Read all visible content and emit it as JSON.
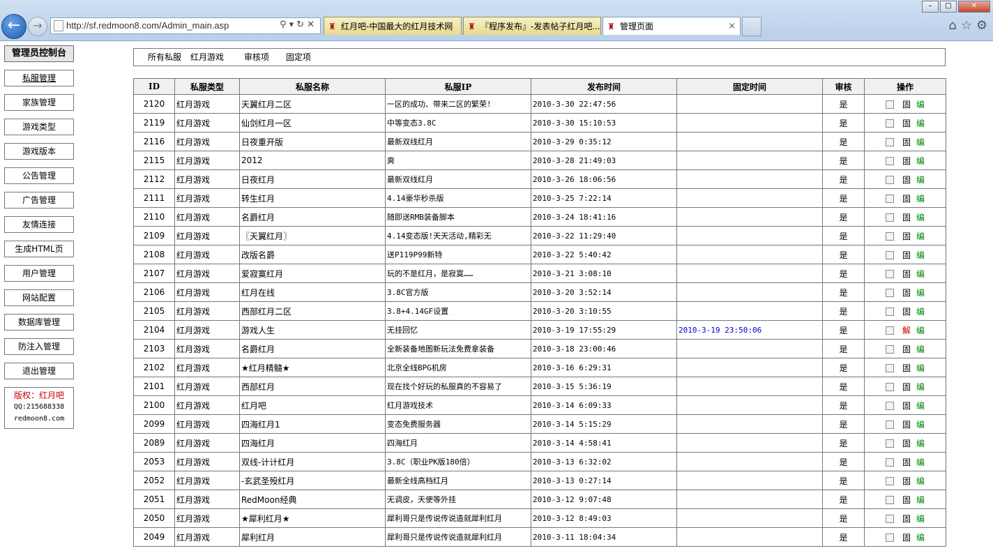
{
  "browser": {
    "url": "http://sf.redmoon8.com/Admin_main.asp",
    "tabs": [
      {
        "title": "红月吧-中国最大的红月技术网"
      },
      {
        "title": "『程序发布』-发表帖子红月吧..."
      },
      {
        "title": "管理页面"
      }
    ],
    "tab_close": "×"
  },
  "sidebar": {
    "title": "管理员控制台",
    "items": [
      {
        "label": "私服管理"
      },
      {
        "label": "家族管理"
      },
      {
        "label": "游戏类型"
      },
      {
        "label": "游戏版本"
      },
      {
        "label": "公告管理"
      },
      {
        "label": "广告管理"
      },
      {
        "label": "友情连接"
      },
      {
        "label": "生成HTML页"
      },
      {
        "label": "用户管理"
      },
      {
        "label": "网站配置"
      },
      {
        "label": "数据库管理"
      },
      {
        "label": "防注入管理"
      },
      {
        "label": "退出管理"
      }
    ],
    "copyright": {
      "owner": "版权：红月吧",
      "qq": "QQ:215688338",
      "site": "redmoon8.com"
    }
  },
  "filters": {
    "all": "所有私服",
    "game": "红月游戏",
    "review": "审核项",
    "fixed": "固定项"
  },
  "table": {
    "headers": {
      "id": "ID",
      "type": "私服类型",
      "name": "私服名称",
      "ip": "私服IP",
      "time": "发布时间",
      "fixed": "固定时间",
      "review": "审核",
      "ops": "操作"
    },
    "fix_label": "固",
    "unfix_label": "解",
    "edit_label": "编",
    "rows": [
      {
        "id": "2120",
        "type": "红月游戏",
        "name": "天翼红月二区",
        "ip": "一区的成功、带来二区的繁荣!",
        "time": "2010-3-30 22:47:56",
        "fixed": "",
        "review": "是",
        "op": "固"
      },
      {
        "id": "2119",
        "type": "红月游戏",
        "name": "仙剑红月一区",
        "ip": "中等变态3.8C",
        "time": "2010-3-30 15:10:53",
        "fixed": "",
        "review": "是",
        "op": "固"
      },
      {
        "id": "2116",
        "type": "红月游戏",
        "name": "日夜重开版",
        "ip": "最新双线红月",
        "time": "2010-3-29 0:35:12",
        "fixed": "",
        "review": "是",
        "op": "固"
      },
      {
        "id": "2115",
        "type": "红月游戏",
        "name": "2012",
        "ip": "爽",
        "time": "2010-3-28 21:49:03",
        "fixed": "",
        "review": "是",
        "op": "固"
      },
      {
        "id": "2112",
        "type": "红月游戏",
        "name": "日夜红月",
        "ip": "最新双线红月",
        "time": "2010-3-26 18:06:56",
        "fixed": "",
        "review": "是",
        "op": "固"
      },
      {
        "id": "2111",
        "type": "红月游戏",
        "name": "转生红月",
        "ip": "4.14豪华秒杀版",
        "time": "2010-3-25 7:22:14",
        "fixed": "",
        "review": "是",
        "op": "固"
      },
      {
        "id": "2110",
        "type": "红月游戏",
        "name": "名爵红月",
        "ip": "随即送RMB装备脚本",
        "time": "2010-3-24 18:41:16",
        "fixed": "",
        "review": "是",
        "op": "固"
      },
      {
        "id": "2109",
        "type": "红月游戏",
        "name": "〖天翼红月〗",
        "ip": "4.14变态版!天天活动,精彩无",
        "time": "2010-3-22 11:29:40",
        "fixed": "",
        "review": "是",
        "op": "固"
      },
      {
        "id": "2108",
        "type": "红月游戏",
        "name": "改版名爵",
        "ip": "送P119P99新特",
        "time": "2010-3-22 5:40:42",
        "fixed": "",
        "review": "是",
        "op": "固"
      },
      {
        "id": "2107",
        "type": "红月游戏",
        "name": "爱寂寞红月",
        "ip": "玩的不是红月，是寂寞……",
        "time": "2010-3-21 3:08:10",
        "fixed": "",
        "review": "是",
        "op": "固"
      },
      {
        "id": "2106",
        "type": "红月游戏",
        "name": "红月在线",
        "ip": "3.8C官方版",
        "time": "2010-3-20 3:52:14",
        "fixed": "",
        "review": "是",
        "op": "固"
      },
      {
        "id": "2105",
        "type": "红月游戏",
        "name": "西部红月二区",
        "ip": "3.8+4.14GF设置",
        "time": "2010-3-20 3:10:55",
        "fixed": "",
        "review": "是",
        "op": "固"
      },
      {
        "id": "2104",
        "type": "红月游戏",
        "name": "游戏人生",
        "ip": "无挂回忆",
        "time": "2010-3-19 17:55:29",
        "fixed": "2010-3-19 23:50:06",
        "review": "是",
        "op": "解"
      },
      {
        "id": "2103",
        "type": "红月游戏",
        "name": "名爵红月",
        "ip": "全新装备地图新玩法免费拿装备",
        "time": "2010-3-18 23:00:46",
        "fixed": "",
        "review": "是",
        "op": "固"
      },
      {
        "id": "2102",
        "type": "红月游戏",
        "name": "★红月精髓★",
        "ip": "北京全线BPG机房",
        "time": "2010-3-16 6:29:31",
        "fixed": "",
        "review": "是",
        "op": "固"
      },
      {
        "id": "2101",
        "type": "红月游戏",
        "name": "西部红月",
        "ip": "现在找个好玩的私服真的不容易了",
        "time": "2010-3-15 5:36:19",
        "fixed": "",
        "review": "是",
        "op": "固"
      },
      {
        "id": "2100",
        "type": "红月游戏",
        "name": "红月吧",
        "ip": "红月游戏技术",
        "time": "2010-3-14 6:09:33",
        "fixed": "",
        "review": "是",
        "op": "固"
      },
      {
        "id": "2099",
        "type": "红月游戏",
        "name": "四海红月1",
        "ip": "变态免费服务器",
        "time": "2010-3-14 5:15:29",
        "fixed": "",
        "review": "是",
        "op": "固"
      },
      {
        "id": "2089",
        "type": "红月游戏",
        "name": "四海红月",
        "ip": "四海红月",
        "time": "2010-3-14 4:58:41",
        "fixed": "",
        "review": "是",
        "op": "固"
      },
      {
        "id": "2053",
        "type": "红月游戏",
        "name": "双线-计计红月",
        "ip": "3.8C（职业PK版180倍）",
        "time": "2010-3-13 6:32:02",
        "fixed": "",
        "review": "是",
        "op": "固"
      },
      {
        "id": "2052",
        "type": "红月游戏",
        "name": "-玄武圣殁红月",
        "ip": "最新全线高档红月",
        "time": "2010-3-13 0:27:14",
        "fixed": "",
        "review": "是",
        "op": "固"
      },
      {
        "id": "2051",
        "type": "红月游戏",
        "name": "RedMoon经典",
        "ip": "无调皮，天使等外挂",
        "time": "2010-3-12 9:07:48",
        "fixed": "",
        "review": "是",
        "op": "固"
      },
      {
        "id": "2050",
        "type": "红月游戏",
        "name": "★犀利红月★",
        "ip": "犀利哥只是传说传说造就犀利红月",
        "time": "2010-3-12 8:49:03",
        "fixed": "",
        "review": "是",
        "op": "固"
      },
      {
        "id": "2049",
        "type": "红月游戏",
        "name": "犀利红月",
        "ip": "犀利哥只是传说传说造就犀利红月",
        "time": "2010-3-11 18:04:34",
        "fixed": "",
        "review": "是",
        "op": "固"
      }
    ]
  }
}
